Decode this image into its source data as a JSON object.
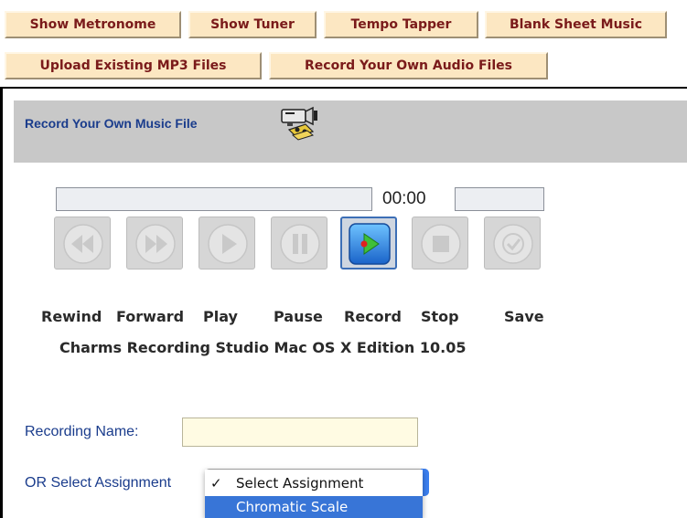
{
  "toolbar": {
    "buttons": [
      "Show Metronome",
      "Show Tuner",
      "Tempo Tapper",
      "Blank Sheet Music",
      "Upload Existing MP3 Files",
      "Record Your Own Audio Files"
    ]
  },
  "panel": {
    "title": "Record Your Own Music File",
    "icon": "camcorder-icon"
  },
  "recorder": {
    "time": "00:00",
    "controls": [
      {
        "label": "Rewind",
        "icon": "rewind-icon",
        "enabled": false
      },
      {
        "label": "Forward",
        "icon": "forward-icon",
        "enabled": false
      },
      {
        "label": "Play",
        "icon": "play-icon",
        "enabled": false
      },
      {
        "label": "Pause",
        "icon": "pause-icon",
        "enabled": false
      },
      {
        "label": "Record",
        "icon": "record-icon",
        "enabled": true
      },
      {
        "label": "Stop",
        "icon": "stop-icon",
        "enabled": false
      },
      {
        "label": "Save",
        "icon": "save-icon",
        "enabled": false
      }
    ],
    "caption": "Charms Recording Studio Mac OS X Edition 10.05"
  },
  "form": {
    "recording_name_label": "Recording Name:",
    "recording_name_value": "",
    "assignment_label": "OR Select Assignment",
    "assignment_options": [
      {
        "label": "Select Assignment",
        "checked": true
      },
      {
        "label": "Chromatic Scale",
        "highlighted": true
      }
    ]
  },
  "colors": {
    "tab_bg": "#fce7c2",
    "tab_text": "#7a1a1a",
    "link_blue": "#1a3c8c",
    "header_gray": "#c8c8c8",
    "menu_highlight": "#3875d7"
  }
}
